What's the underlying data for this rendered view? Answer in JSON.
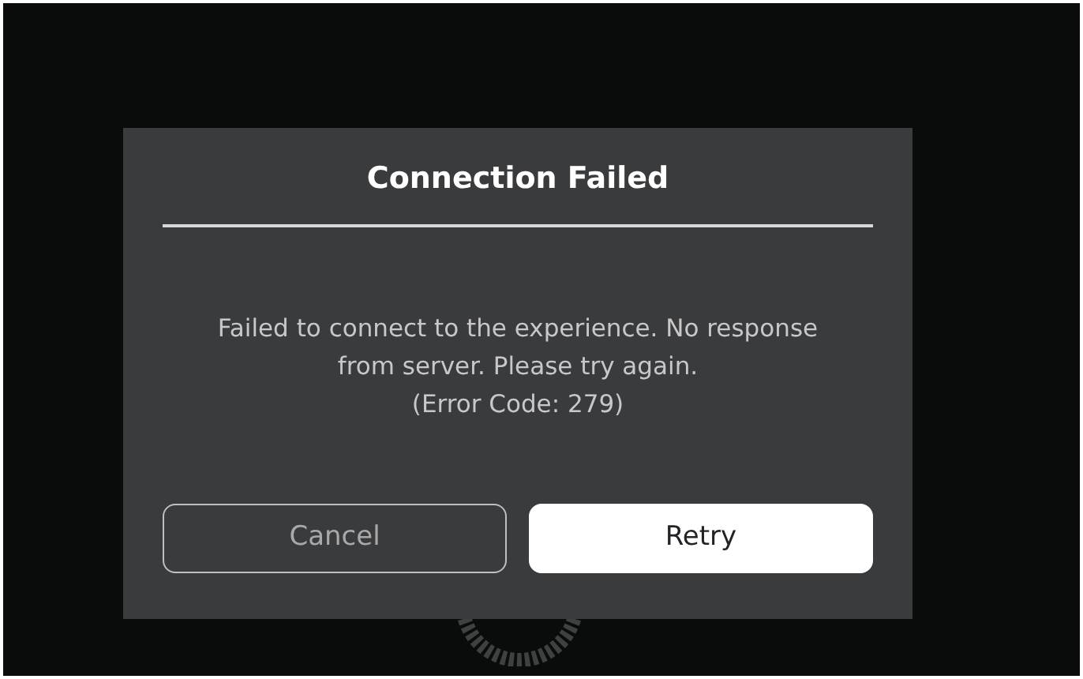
{
  "dialog": {
    "title": "Connection Failed",
    "message": "Failed to connect to the experience. No response from server. Please try again.",
    "error_code": "(Error Code: 279)",
    "buttons": [
      {
        "label": "Cancel",
        "kind": "secondary"
      },
      {
        "label": "Retry",
        "kind": "primary"
      }
    ]
  }
}
